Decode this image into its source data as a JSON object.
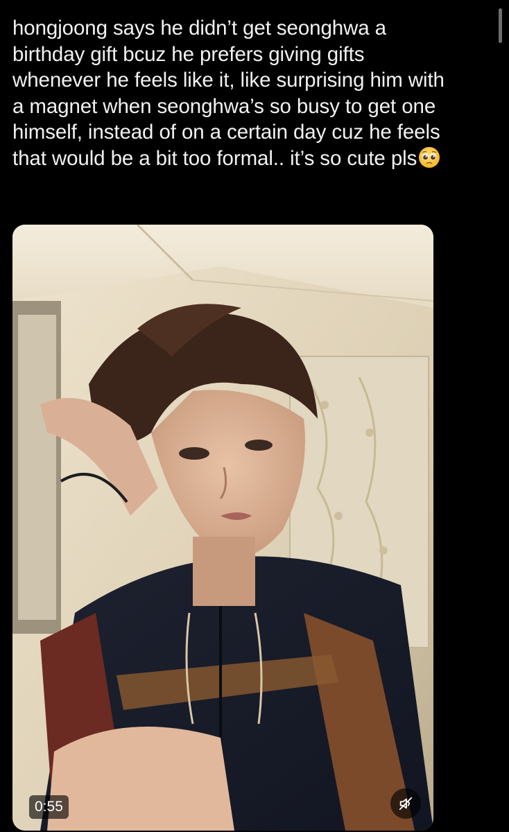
{
  "tweet": {
    "text_lines": [
      "hongjoong says he didn’t get seonghwa a",
      "birthday gift bcuz he prefers giving gifts",
      "whenever he feels like it, like surprising him with",
      "a magnet when seonghwa’s so busy to get one",
      "himself, instead of on a certain day cuz he feels",
      "that would be a bit too formal.. it’s so cute pls"
    ],
    "emoji": "pleading-face-emoji"
  },
  "video": {
    "duration": "0:55",
    "muted": true,
    "mute_icon": "speaker-muted-icon"
  },
  "colors": {
    "background": "#000000",
    "text": "#f2f2f2",
    "overlay": "#000000"
  }
}
